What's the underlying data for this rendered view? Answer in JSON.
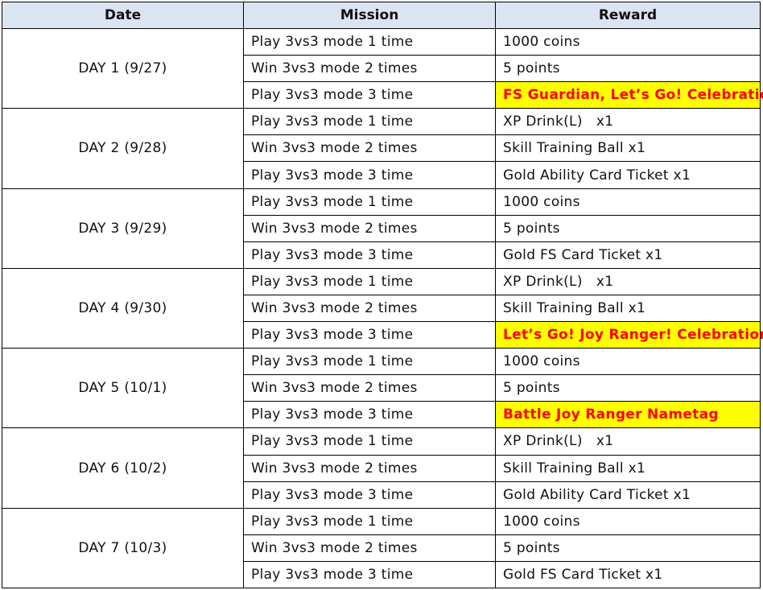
{
  "headers": {
    "date": "Date",
    "mission": "Mission",
    "reward": "Reward"
  },
  "highlight_colors": {
    "background": "#ffff00",
    "text": "#ff0000"
  },
  "days": [
    {
      "date": "DAY 1 (9/27)",
      "rows": [
        {
          "mission": "Play 3vs3 mode 1 time",
          "reward": "1000 coins",
          "highlight": false
        },
        {
          "mission": "Win 3vs3 mode 2 times",
          "reward": "5 points",
          "highlight": false
        },
        {
          "mission": "Play 3vs3 mode 3 time",
          "reward": "FS Guardian, Let’s Go! Celebration",
          "highlight": true
        }
      ]
    },
    {
      "date": "DAY 2 (9/28)",
      "rows": [
        {
          "mission": "Play 3vs3 mode 1 time",
          "reward": "XP Drink(L)   x1",
          "highlight": false
        },
        {
          "mission": "Win 3vs3 mode 2 times",
          "reward": "Skill Training Ball x1",
          "highlight": false
        },
        {
          "mission": "Play 3vs3 mode 3 time",
          "reward": "Gold Ability Card Ticket x1",
          "highlight": false
        }
      ]
    },
    {
      "date": "DAY 3 (9/29)",
      "rows": [
        {
          "mission": "Play 3vs3 mode 1 time",
          "reward": "1000 coins",
          "highlight": false
        },
        {
          "mission": "Win 3vs3 mode 2 times",
          "reward": "5 points",
          "highlight": false
        },
        {
          "mission": "Play 3vs3 mode 3 time",
          "reward": "Gold FS Card Ticket x1",
          "highlight": false
        }
      ]
    },
    {
      "date": "DAY 4 (9/30)",
      "rows": [
        {
          "mission": "Play 3vs3 mode 1 time",
          "reward": "XP Drink(L)   x1",
          "highlight": false
        },
        {
          "mission": "Win 3vs3 mode 2 times",
          "reward": "Skill Training Ball x1",
          "highlight": false
        },
        {
          "mission": "Play 3vs3 mode 3 time",
          "reward": "Let’s Go! Joy Ranger! Celebration",
          "highlight": true
        }
      ]
    },
    {
      "date": "DAY 5 (10/1)",
      "rows": [
        {
          "mission": "Play 3vs3 mode 1 time",
          "reward": "1000 coins",
          "highlight": false
        },
        {
          "mission": "Win 3vs3 mode 2 times",
          "reward": "5 points",
          "highlight": false
        },
        {
          "mission": "Play 3vs3 mode 3 time",
          "reward": "Battle Joy Ranger Nametag",
          "highlight": true
        }
      ]
    },
    {
      "date": "DAY 6 (10/2)",
      "rows": [
        {
          "mission": "Play 3vs3 mode 1 time",
          "reward": "XP Drink(L)   x1",
          "highlight": false
        },
        {
          "mission": "Win 3vs3 mode 2 times",
          "reward": "Skill Training Ball x1",
          "highlight": false
        },
        {
          "mission": "Play 3vs3 mode 3 time",
          "reward": "Gold Ability Card Ticket x1",
          "highlight": false
        }
      ]
    },
    {
      "date": "DAY 7 (10/3)",
      "rows": [
        {
          "mission": "Play 3vs3 mode 1 time",
          "reward": "1000 coins",
          "highlight": false
        },
        {
          "mission": "Win 3vs3 mode 2 times",
          "reward": "5 points",
          "highlight": false
        },
        {
          "mission": "Play 3vs3 mode 3 time",
          "reward": "Gold FS Card Ticket x1",
          "highlight": false
        }
      ]
    }
  ]
}
